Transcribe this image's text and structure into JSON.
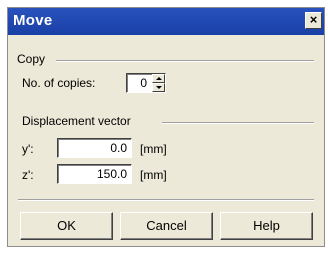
{
  "window": {
    "title": "Move",
    "close_glyph": "×"
  },
  "copy_group": {
    "title": "Copy",
    "copies_label": "No. of copies:",
    "copies_value": "0"
  },
  "displacement_group": {
    "title": "Displacement vector",
    "y_label": "y':",
    "y_value": "0.0",
    "y_unit": "[mm]",
    "z_label": "z':",
    "z_value": "150.0",
    "z_unit": "[mm]"
  },
  "buttons": {
    "ok": "OK",
    "cancel": "Cancel",
    "help": "Help"
  },
  "colors": {
    "title_bar": "#1f4bb4",
    "dialog_bg": "#ece9d8"
  }
}
